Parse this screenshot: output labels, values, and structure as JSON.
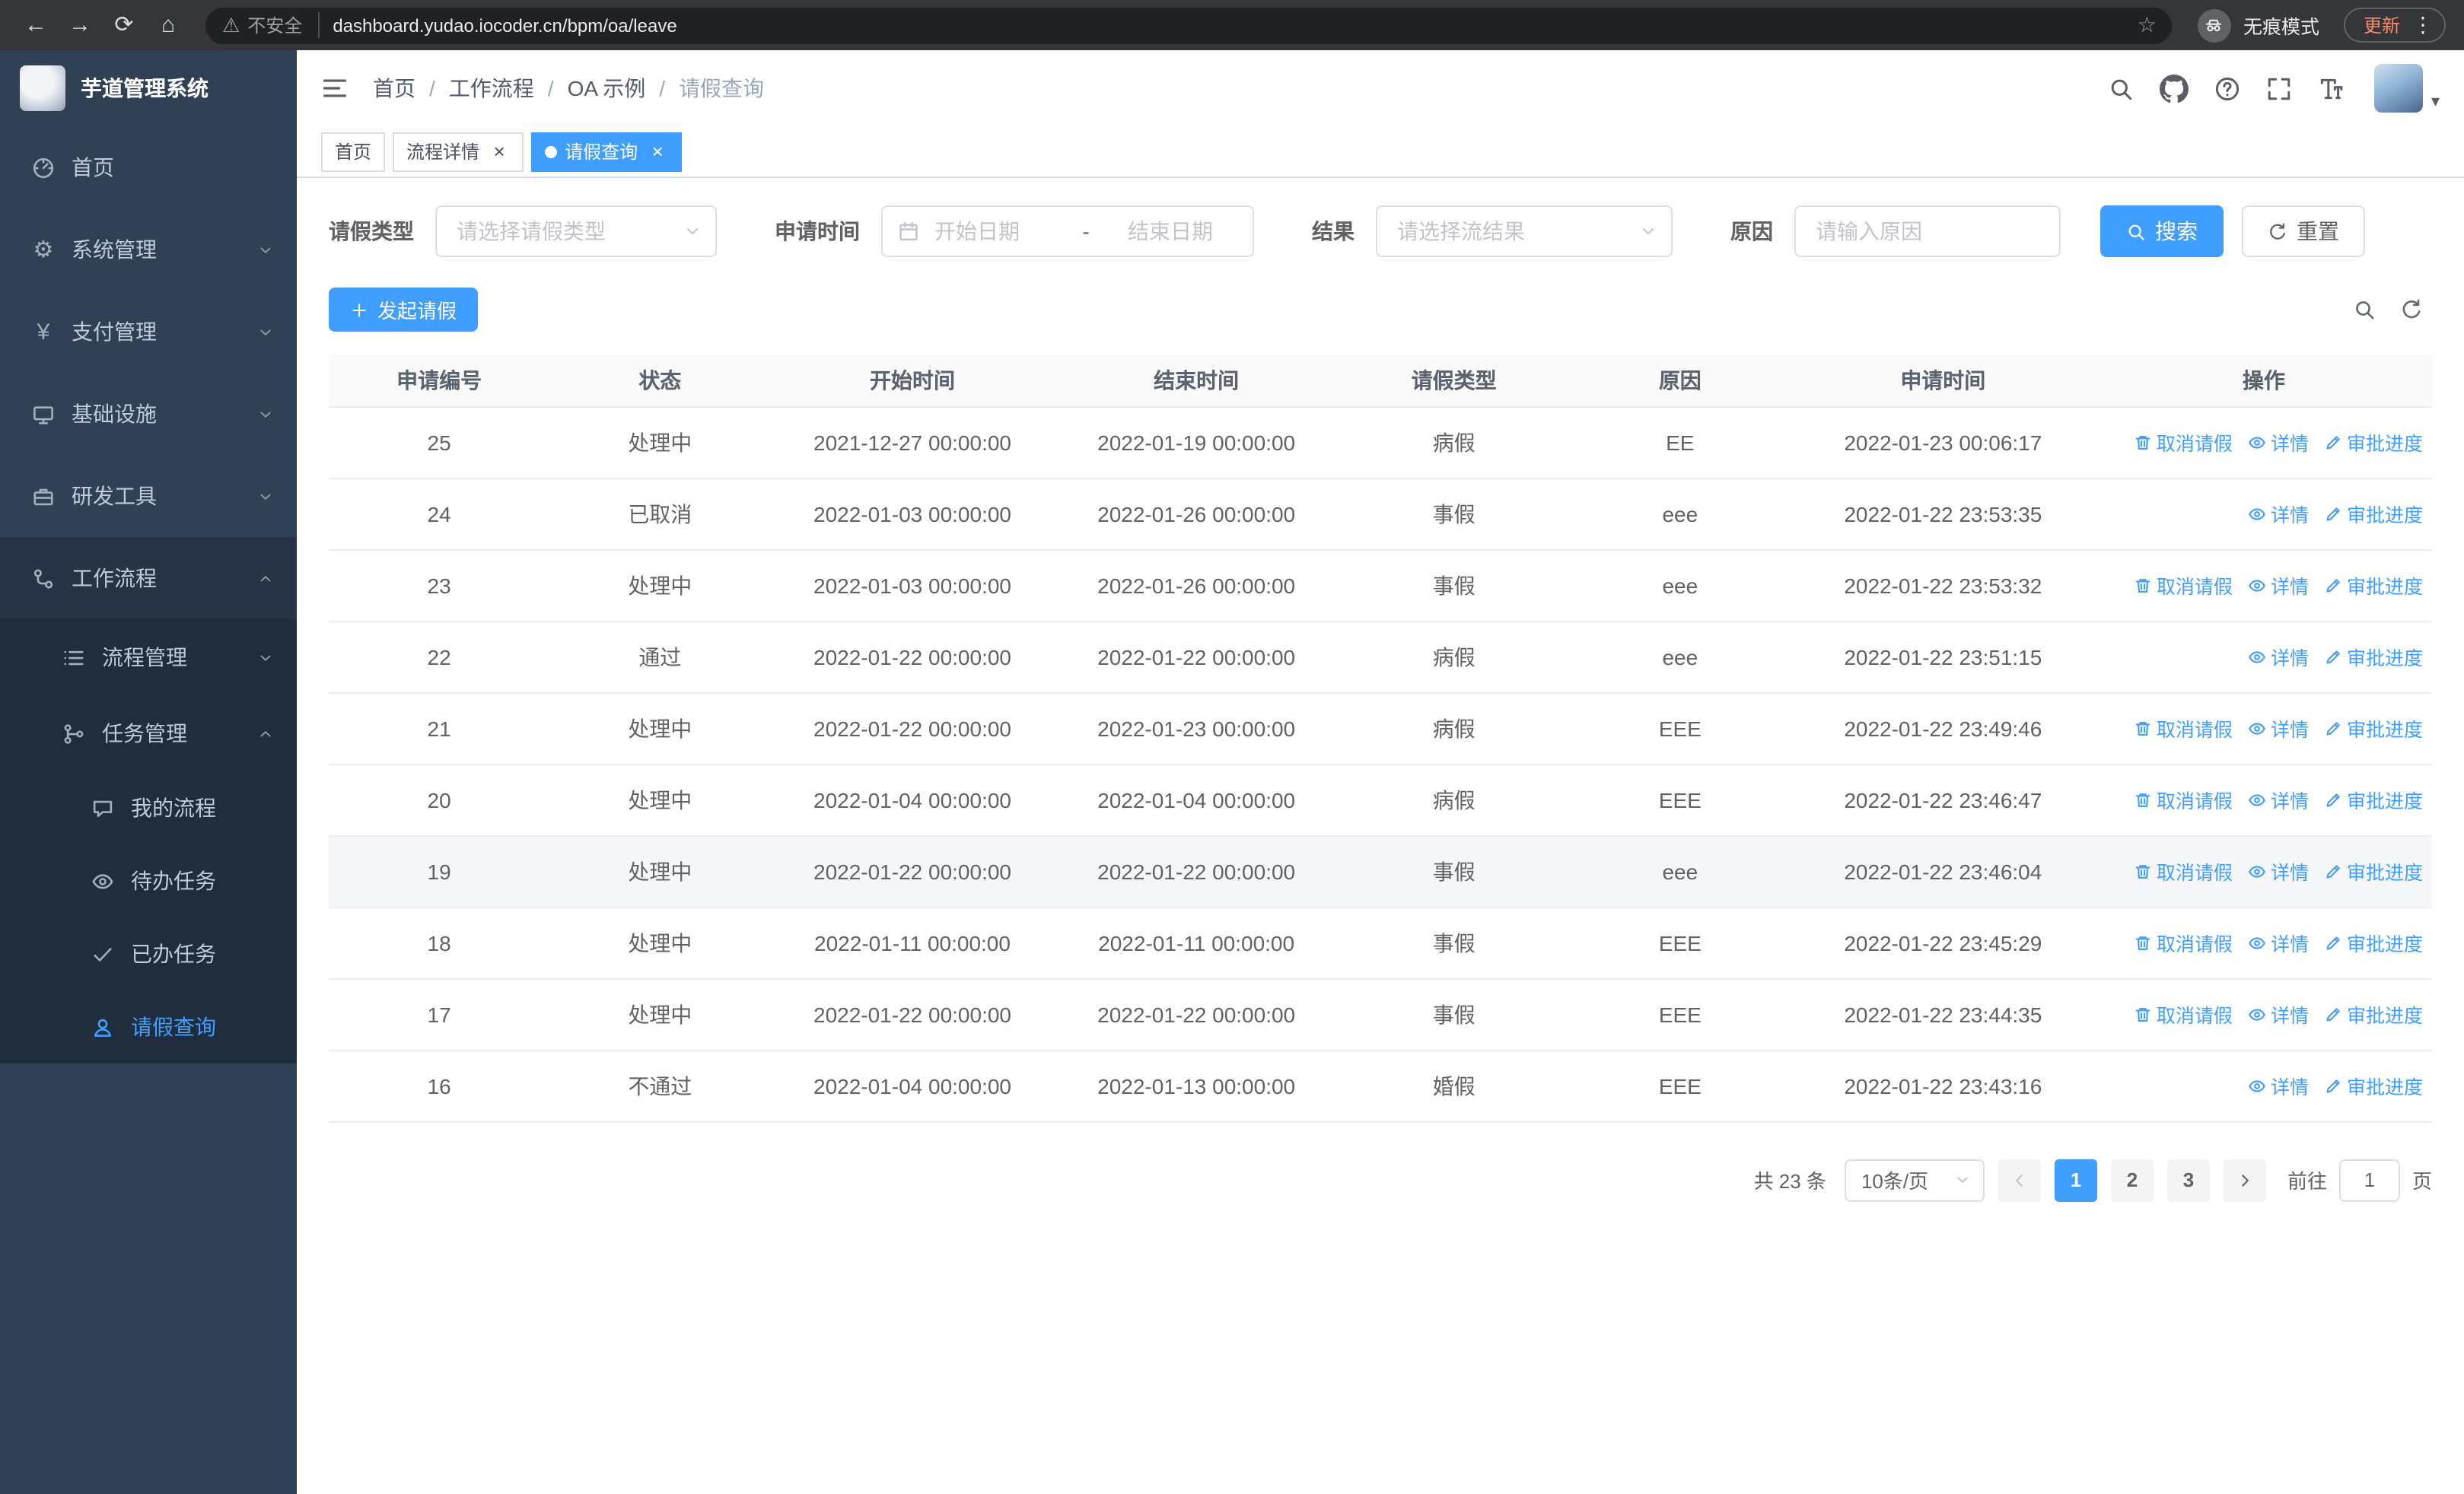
{
  "browser": {
    "security_warning": "不安全",
    "url": "dashboard.yudao.iocoder.cn/bpm/oa/leave",
    "incognito_label": "无痕模式",
    "update_button": "更新"
  },
  "sidebar": {
    "title": "芋道管理系统",
    "menu": [
      {
        "id": "home",
        "label": "首页",
        "icon": "dashboard-icon",
        "level": 1
      },
      {
        "id": "system-management",
        "label": "系统管理",
        "icon": "gear-icon",
        "level": 1,
        "chevron": "down"
      },
      {
        "id": "payment-management",
        "label": "支付管理",
        "icon": "yen-icon",
        "level": 1,
        "chevron": "down"
      },
      {
        "id": "infrastructure",
        "label": "基础设施",
        "icon": "monitor-icon",
        "level": 1,
        "chevron": "down"
      },
      {
        "id": "dev-tools",
        "label": "研发工具",
        "icon": "tools-icon",
        "level": 1,
        "chevron": "down"
      },
      {
        "id": "workflow",
        "label": "工作流程",
        "icon": "workflow-icon",
        "level": 1,
        "chevron": "up",
        "expanded": true
      },
      {
        "id": "process-management",
        "label": "流程管理",
        "icon": "process-icon",
        "level": 2,
        "chevron": "down"
      },
      {
        "id": "task-management",
        "label": "任务管理",
        "icon": "task-icon",
        "level": 2,
        "chevron": "up",
        "expanded": true
      },
      {
        "id": "my-process",
        "label": "我的流程",
        "icon": "my-process-icon",
        "level": 3
      },
      {
        "id": "todo-tasks",
        "label": "待办任务",
        "icon": "todo-icon",
        "level": 3
      },
      {
        "id": "done-tasks",
        "label": "已办任务",
        "icon": "done-icon",
        "level": 3
      },
      {
        "id": "leave-query",
        "label": "请假查询",
        "icon": "leave-icon",
        "level": 3,
        "active": true
      }
    ]
  },
  "breadcrumb": {
    "separator": "/",
    "items": [
      "首页",
      "工作流程",
      "OA 示例",
      "请假查询"
    ]
  },
  "tabs": [
    {
      "id": "home",
      "label": "首页",
      "closable": false,
      "active": false
    },
    {
      "id": "process-detail",
      "label": "流程详情",
      "closable": true,
      "active": false
    },
    {
      "id": "leave-query",
      "label": "请假查询",
      "closable": true,
      "active": true
    }
  ],
  "filters": {
    "leave_type_label": "请假类型",
    "leave_type_placeholder": "请选择请假类型",
    "apply_time_label": "申请时间",
    "start_date_placeholder": "开始日期",
    "date_separator": "-",
    "end_date_placeholder": "结束日期",
    "result_label": "结果",
    "result_placeholder": "请选择流结果",
    "reason_label": "原因",
    "reason_placeholder": "请输入原因",
    "search_button": "搜索",
    "reset_button": "重置"
  },
  "toolbar": {
    "create_button": "发起请假"
  },
  "table": {
    "columns": [
      "申请编号",
      "状态",
      "开始时间",
      "结束时间",
      "请假类型",
      "原因",
      "申请时间",
      "操作"
    ],
    "action_defs": [
      {
        "key": "cancel",
        "label": "取消请假",
        "icon": "trash-icon"
      },
      {
        "key": "detail",
        "label": "详情",
        "icon": "eye-icon"
      },
      {
        "key": "progress",
        "label": "审批进度",
        "icon": "edit-icon"
      }
    ],
    "rows": [
      {
        "id": "25",
        "status": "处理中",
        "start_time": "2021-12-27 00:00:00",
        "end_time": "2022-01-19 00:00:00",
        "leave_type": "病假",
        "reason": "EE",
        "apply_time": "2022-01-23 00:06:17",
        "actions": [
          "cancel",
          "detail",
          "progress"
        ]
      },
      {
        "id": "24",
        "status": "已取消",
        "start_time": "2022-01-03 00:00:00",
        "end_time": "2022-01-26 00:00:00",
        "leave_type": "事假",
        "reason": "eee",
        "apply_time": "2022-01-22 23:53:35",
        "actions": [
          "detail",
          "progress"
        ]
      },
      {
        "id": "23",
        "status": "处理中",
        "start_time": "2022-01-03 00:00:00",
        "end_time": "2022-01-26 00:00:00",
        "leave_type": "事假",
        "reason": "eee",
        "apply_time": "2022-01-22 23:53:32",
        "actions": [
          "cancel",
          "detail",
          "progress"
        ]
      },
      {
        "id": "22",
        "status": "通过",
        "start_time": "2022-01-22 00:00:00",
        "end_time": "2022-01-22 00:00:00",
        "leave_type": "病假",
        "reason": "eee",
        "apply_time": "2022-01-22 23:51:15",
        "actions": [
          "detail",
          "progress"
        ]
      },
      {
        "id": "21",
        "status": "处理中",
        "start_time": "2022-01-22 00:00:00",
        "end_time": "2022-01-23 00:00:00",
        "leave_type": "病假",
        "reason": "EEE",
        "apply_time": "2022-01-22 23:49:46",
        "actions": [
          "cancel",
          "detail",
          "progress"
        ]
      },
      {
        "id": "20",
        "status": "处理中",
        "start_time": "2022-01-04 00:00:00",
        "end_time": "2022-01-04 00:00:00",
        "leave_type": "病假",
        "reason": "EEE",
        "apply_time": "2022-01-22 23:46:47",
        "actions": [
          "cancel",
          "detail",
          "progress"
        ]
      },
      {
        "id": "19",
        "status": "处理中",
        "start_time": "2022-01-22 00:00:00",
        "end_time": "2022-01-22 00:00:00",
        "leave_type": "事假",
        "reason": "eee",
        "apply_time": "2022-01-22 23:46:04",
        "actions": [
          "cancel",
          "detail",
          "progress"
        ],
        "highlighted": true
      },
      {
        "id": "18",
        "status": "处理中",
        "start_time": "2022-01-11 00:00:00",
        "end_time": "2022-01-11 00:00:00",
        "leave_type": "事假",
        "reason": "EEE",
        "apply_time": "2022-01-22 23:45:29",
        "actions": [
          "cancel",
          "detail",
          "progress"
        ]
      },
      {
        "id": "17",
        "status": "处理中",
        "start_time": "2022-01-22 00:00:00",
        "end_time": "2022-01-22 00:00:00",
        "leave_type": "事假",
        "reason": "EEE",
        "apply_time": "2022-01-22 23:44:35",
        "actions": [
          "cancel",
          "detail",
          "progress"
        ]
      },
      {
        "id": "16",
        "status": "不通过",
        "start_time": "2022-01-04 00:00:00",
        "end_time": "2022-01-13 00:00:00",
        "leave_type": "婚假",
        "reason": "EEE",
        "apply_time": "2022-01-22 23:43:16",
        "actions": [
          "detail",
          "progress"
        ]
      }
    ]
  },
  "pagination": {
    "total_text": "共 23 条",
    "page_size": "10条/页",
    "pages": [
      {
        "label": "1",
        "active": true
      },
      {
        "label": "2",
        "active": false
      },
      {
        "label": "3",
        "active": false
      }
    ],
    "goto_label": "前往",
    "goto_value": "1",
    "goto_unit": "页"
  },
  "colors": {
    "primary": "#409eff",
    "sidebar_bg": "#304156",
    "submenu_bg": "#1f2d3d"
  }
}
